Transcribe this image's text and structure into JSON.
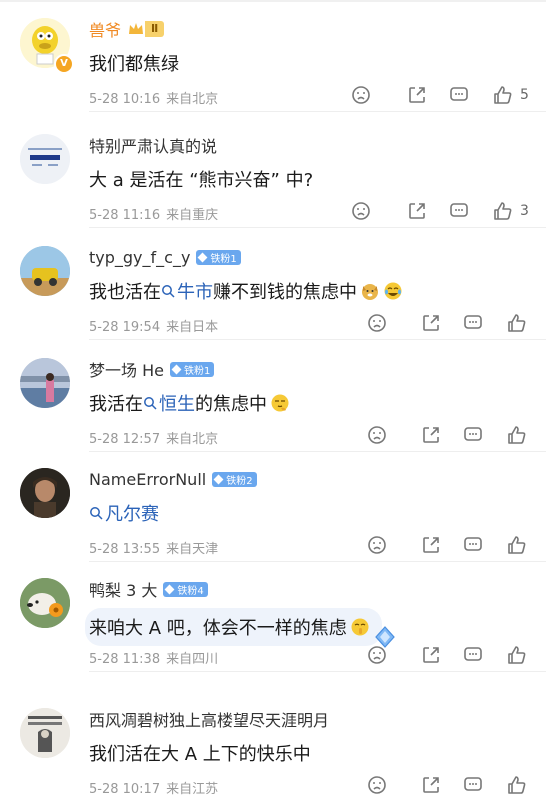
{
  "comments": [
    {
      "user": "兽爷",
      "level_badge": "Ⅱ",
      "text": "我们都焦绿",
      "date": "5-28 10:16",
      "location": "来自北京",
      "likes": "5"
    },
    {
      "user": "特别严肃认真的说",
      "avatar_text": "把呀把呀把",
      "text": "大 a 是活在 “熊市兴奋” 中?",
      "date": "5-28 11:16",
      "location": "来自重庆",
      "likes": "3"
    },
    {
      "user": "typ_gy_f_c_y",
      "fan_badge": "铁粉1",
      "text_before": "我也活在",
      "topic": "牛市",
      "text_after": "赚不到钱的焦虑中",
      "date": "5-28 19:54",
      "location": "来自日本"
    },
    {
      "user": "梦一场 He",
      "fan_badge": "铁粉1",
      "text_before": "我活在",
      "topic": "恒生",
      "text_after": "的焦虑中",
      "date": "5-28 12:57",
      "location": "来自北京"
    },
    {
      "user": "NameErrorNull",
      "fan_badge": "铁粉2",
      "topic": "凡尔赛",
      "date": "5-28 13:55",
      "location": "来自天津"
    },
    {
      "user": "鸭梨 3 大",
      "fan_badge": "铁粉4",
      "text": "来咱大 A 吧，体会不一样的焦虑",
      "date": "5-28 11:38",
      "location": "来自四川"
    },
    {
      "user": "西风凋碧树独上高楼望尽天涯明月",
      "text": "我们活在大 A 上下的快乐中",
      "date": "5-28 10:17",
      "location": "来自江苏"
    }
  ],
  "colors": {
    "vip_name": "#f08a24",
    "topic_link": "#2b63b8",
    "fan_badge": "#6aa7ee",
    "meta_text": "#999999"
  },
  "icons": {
    "vote_down": "thumb-down-face-icon",
    "share": "share-icon",
    "reply": "comment-icon",
    "like": "thumbs-up-icon"
  }
}
